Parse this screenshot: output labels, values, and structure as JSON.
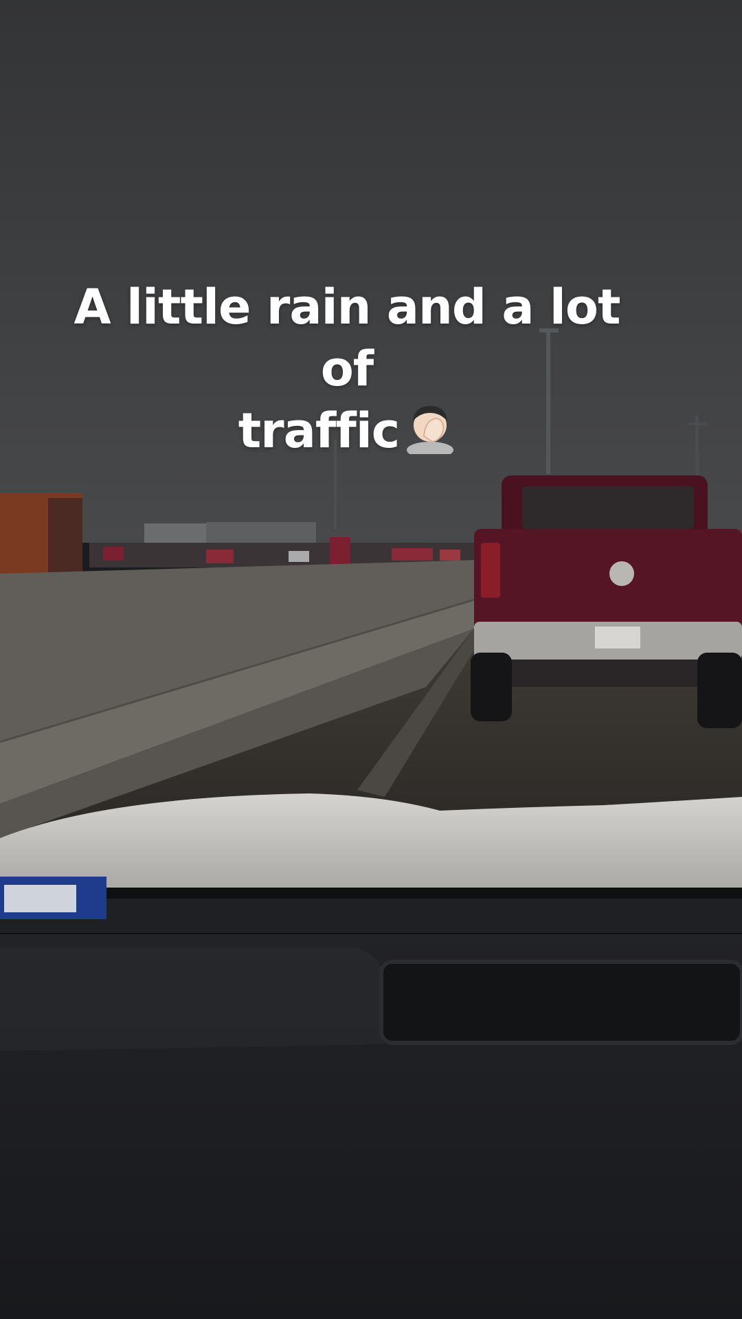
{
  "caption": {
    "line1": "A little rain and a lot of",
    "line2": "traffic",
    "emoji_name": "facepalm-emoji"
  },
  "scene": {
    "description_tag": "rainy-highway-dashcam",
    "colors": {
      "sky": "#3a3b3d",
      "barrier": "#5e5a55",
      "road": "#37332f",
      "truck": "#4f1420",
      "hood": "#c9c7c3",
      "dashboard": "#1a1b1e"
    }
  }
}
